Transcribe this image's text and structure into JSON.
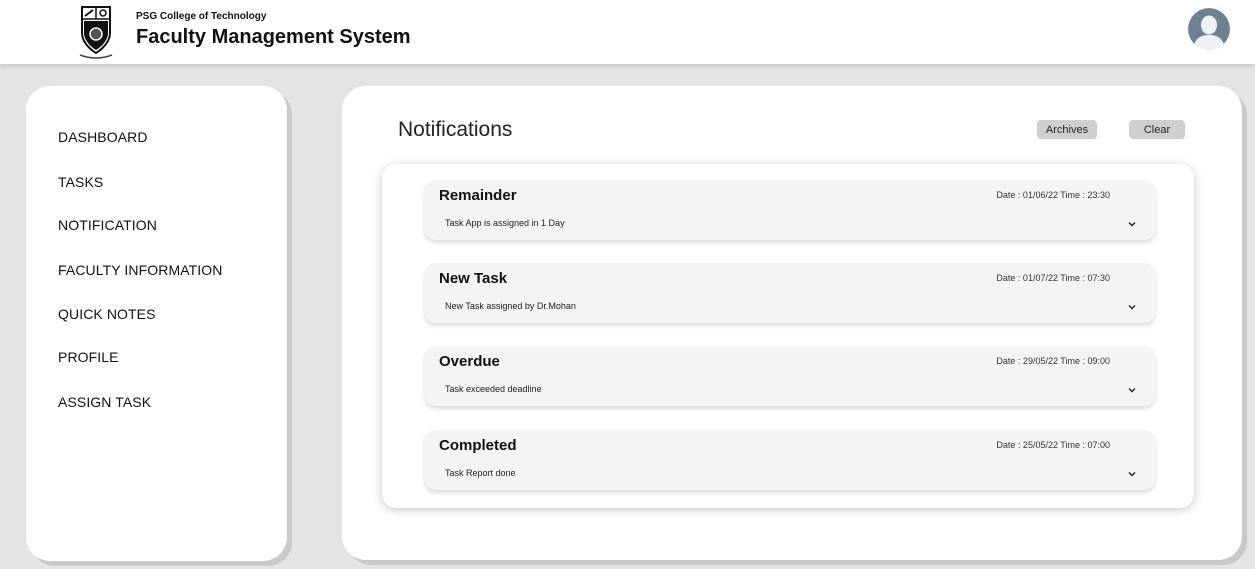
{
  "header": {
    "college_name": "PSG College of Technology",
    "app_title": "Faculty Management System"
  },
  "sidebar": {
    "items": [
      {
        "label": "DASHBOARD"
      },
      {
        "label": "TASKS"
      },
      {
        "label": "NOTIFICATION"
      },
      {
        "label": "FACULTY INFORMATION"
      },
      {
        "label": "QUICK NOTES"
      },
      {
        "label": "PROFILE"
      },
      {
        "label": "ASSIGN TASK"
      }
    ]
  },
  "main": {
    "title": "Notifications",
    "archives_label": "Archives",
    "clear_label": "Clear"
  },
  "notifications": [
    {
      "title": "Remainder",
      "datetime": "Date : 01/06/22 Time : 23:30",
      "description": "Task App is assigned in 1 Day"
    },
    {
      "title": "New Task",
      "datetime": "Date : 01/07/22 Time : 07:30",
      "description": "New Task assigned by Dr.Mohan"
    },
    {
      "title": "Overdue",
      "datetime": "Date : 29/05/22 Time : 09:00",
      "description": "Task exceeded deadline"
    },
    {
      "title": "Completed",
      "datetime": "Date : 25/05/22 Time : 07:00",
      "description": "Task Report done"
    }
  ],
  "icons": {
    "logo": "college-crest-icon",
    "avatar": "user-avatar-icon",
    "expand": "chevron-down-icon"
  },
  "colors": {
    "page_bg": "#e4e4e4",
    "panel_bg": "#ffffff",
    "card_bg": "#f4f4f4",
    "button_bg": "#cfcfcf",
    "avatar_bg": "#6d8192"
  }
}
